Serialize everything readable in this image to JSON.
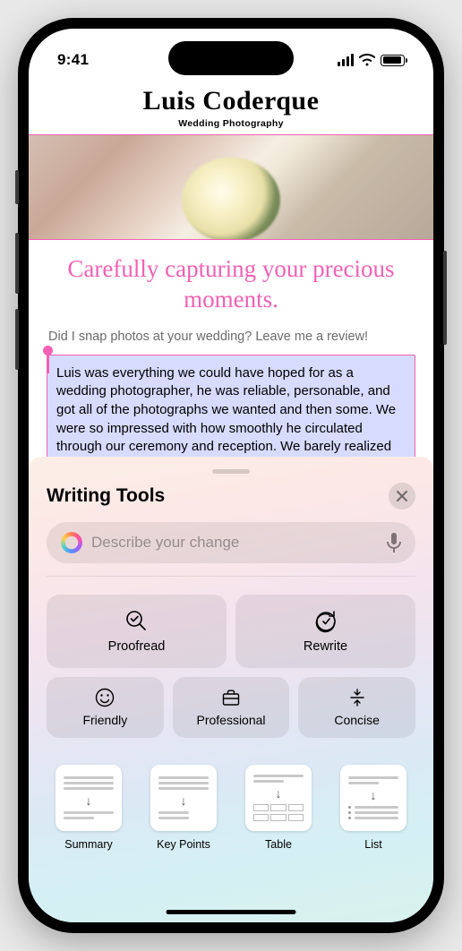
{
  "status": {
    "time": "9:41"
  },
  "document": {
    "title": "Luis Coderque",
    "subtitle": "Wedding Photography",
    "tagline": "Carefully capturing your precious moments.",
    "review_prompt": "Did I snap photos at your wedding? Leave me a review!",
    "selected_text": "Luis was everything we could have hoped for as a wedding photographer, he was reliable, personable, and got all of the photographs we wanted and then some. We were so impressed with how smoothly he circulated through our ceremony and reception. We barely realized he was there except when he was very"
  },
  "panel": {
    "title": "Writing Tools",
    "input_placeholder": "Describe your change",
    "tools": {
      "proofread": "Proofread",
      "rewrite": "Rewrite",
      "friendly": "Friendly",
      "professional": "Professional",
      "concise": "Concise"
    },
    "formats": {
      "summary": "Summary",
      "keypoints": "Key Points",
      "table": "Table",
      "list": "List"
    }
  }
}
